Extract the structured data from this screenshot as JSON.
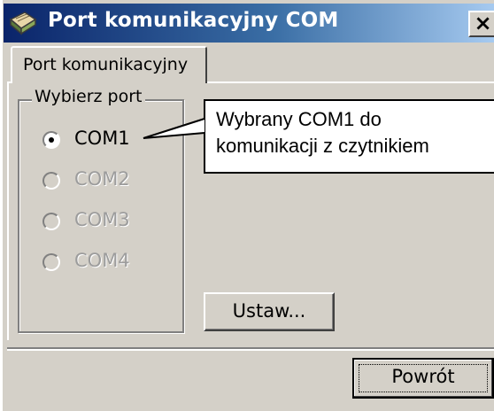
{
  "window": {
    "title": "Port komunikacyjny COM",
    "close_glyph": "×",
    "title_icon": "book-icon"
  },
  "tabs": [
    {
      "label": "Port komunikacyjny",
      "selected": true
    }
  ],
  "port_group": {
    "legend": "Wybierz port",
    "options": [
      {
        "label": "COM1",
        "selected": true,
        "enabled": true
      },
      {
        "label": "COM2",
        "selected": false,
        "enabled": false
      },
      {
        "label": "COM3",
        "selected": false,
        "enabled": false
      },
      {
        "label": "COM4",
        "selected": false,
        "enabled": false
      }
    ]
  },
  "callout": {
    "line1": "Wybrany COM1 do",
    "line2": "komunikacji z czytnikiem"
  },
  "buttons": {
    "set_label": "Ustaw...",
    "back_label": "Powrót"
  },
  "colors": {
    "titlebar_start": "#0a246a",
    "titlebar_end": "#a6caf0",
    "face": "#d4d0c8",
    "disabled_text": "#9c9c9c"
  }
}
